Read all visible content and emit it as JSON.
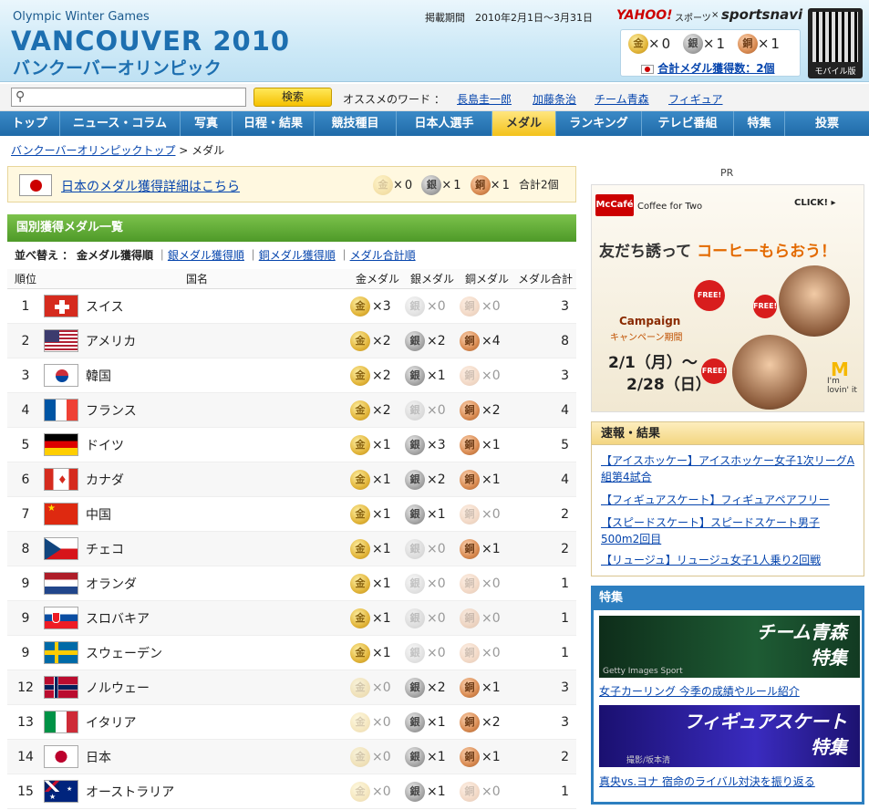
{
  "header": {
    "logo_sub": "Olympic Winter Games",
    "logo_main": "VANCOUVER 2010",
    "logo_jp": "バンクーバーオリンピック",
    "period": "掲載期間　2010年2月1日〜3月31日",
    "yahoo": "YAHOO!",
    "yahoo_sports": "スポーツ",
    "x_mark": "×",
    "sportsnavi": "sportsnavi",
    "medals": {
      "gold": "0",
      "silver": "1",
      "bronze": "1"
    },
    "total_link": "合計メダル獲得数：2個",
    "mobile": "モバイル版",
    "times": "×"
  },
  "medal_icons": {
    "gold": "金",
    "silver": "銀",
    "bronze": "銅"
  },
  "search": {
    "button": "検索",
    "keywords_label": "オススメのワード ：",
    "keywords": [
      "長島圭一郎",
      "加藤条治",
      "チーム青森",
      "フィギュア"
    ]
  },
  "nav": [
    "トップ",
    "ニュース・コラム",
    "写真",
    "日程・結果",
    "競技種目",
    "日本人選手",
    "メダル",
    "ランキング",
    "テレビ番組",
    "特集",
    "投票"
  ],
  "nav_active": "メダル",
  "breadcrumb": {
    "home": "バンクーバーオリンピックトップ",
    "sep": " > ",
    "current": "メダル"
  },
  "japan_box": {
    "link": "日本のメダル獲得詳細はこちら",
    "gold": "0",
    "silver": "1",
    "bronze": "1",
    "total": "合計2個"
  },
  "section_title": "国別獲得メダル一覧",
  "sort": {
    "label": "並べ替え ：",
    "current": "金メダル獲得順",
    "sep": "｜",
    "options": [
      "銀メダル獲得順",
      "銅メダル獲得順",
      "メダル合計順"
    ]
  },
  "table": {
    "headers": {
      "rank": "順位",
      "name": "国名",
      "gold": "金メダル",
      "silver": "銀メダル",
      "bronze": "銅メダル",
      "total": "メダル合計"
    },
    "rows": [
      {
        "rank": "1",
        "name": "スイス",
        "flag": "switzerland",
        "gold": "3",
        "silver": "0",
        "bronze": "0",
        "total": "3"
      },
      {
        "rank": "2",
        "name": "アメリカ",
        "flag": "usa",
        "gold": "2",
        "silver": "2",
        "bronze": "4",
        "total": "8"
      },
      {
        "rank": "3",
        "name": "韓国",
        "flag": "korea",
        "gold": "2",
        "silver": "1",
        "bronze": "0",
        "total": "3"
      },
      {
        "rank": "4",
        "name": "フランス",
        "flag": "france",
        "gold": "2",
        "silver": "0",
        "bronze": "2",
        "total": "4"
      },
      {
        "rank": "5",
        "name": "ドイツ",
        "flag": "germany",
        "gold": "1",
        "silver": "3",
        "bronze": "1",
        "total": "5"
      },
      {
        "rank": "6",
        "name": "カナダ",
        "flag": "canada",
        "gold": "1",
        "silver": "2",
        "bronze": "1",
        "total": "4"
      },
      {
        "rank": "7",
        "name": "中国",
        "flag": "china",
        "gold": "1",
        "silver": "1",
        "bronze": "0",
        "total": "2"
      },
      {
        "rank": "8",
        "name": "チェコ",
        "flag": "czech",
        "gold": "1",
        "silver": "0",
        "bronze": "1",
        "total": "2"
      },
      {
        "rank": "9",
        "name": "オランダ",
        "flag": "netherlands",
        "gold": "1",
        "silver": "0",
        "bronze": "0",
        "total": "1"
      },
      {
        "rank": "9",
        "name": "スロバキア",
        "flag": "slovakia",
        "gold": "1",
        "silver": "0",
        "bronze": "0",
        "total": "1"
      },
      {
        "rank": "9",
        "name": "スウェーデン",
        "flag": "sweden",
        "gold": "1",
        "silver": "0",
        "bronze": "0",
        "total": "1"
      },
      {
        "rank": "12",
        "name": "ノルウェー",
        "flag": "norway",
        "gold": "0",
        "silver": "2",
        "bronze": "1",
        "total": "3"
      },
      {
        "rank": "13",
        "name": "イタリア",
        "flag": "italy",
        "gold": "0",
        "silver": "1",
        "bronze": "2",
        "total": "3"
      },
      {
        "rank": "14",
        "name": "日本",
        "flag": "japan",
        "gold": "0",
        "silver": "1",
        "bronze": "1",
        "total": "2"
      },
      {
        "rank": "15",
        "name": "オーストラリア",
        "flag": "australia",
        "gold": "0",
        "silver": "1",
        "bronze": "0",
        "total": "1"
      }
    ]
  },
  "ad": {
    "pr": "PR",
    "brand": "McCafé",
    "coffee": "Coffee for Two",
    "click": "CLICK! ▸",
    "headline_a": "友だち誘って",
    "headline_b": "コーヒーもらおう！",
    "free": "FREE!",
    "campaign": "Campaign",
    "campaign_jp": "キャンペーン期間",
    "date1": "2/1（月）〜",
    "date2": "2/28（日）",
    "arch": "M",
    "lovin": "I'm lovin' it"
  },
  "news": {
    "title": "速報・結果",
    "items": [
      "【アイスホッケー】アイスホッケー女子1次リーグA組第4試合",
      "【フィギュアスケート】フィギュアペアフリー",
      "【スピードスケート】スピードスケート男子500m2回目",
      "【リュージュ】リュージュ女子1人乗り2回戦"
    ]
  },
  "features": {
    "title": "特集",
    "banner1": "チーム青森\n特集",
    "banner1_credit": "Getty Images Sport",
    "caption1": "女子カーリング 今季の成績やルール紹介",
    "banner2": "フィギュアスケート\n特集",
    "banner2_credit": "撮影/坂本清",
    "caption2": "真央vs.ヨナ 宿命のライバル対決を振り返る"
  }
}
